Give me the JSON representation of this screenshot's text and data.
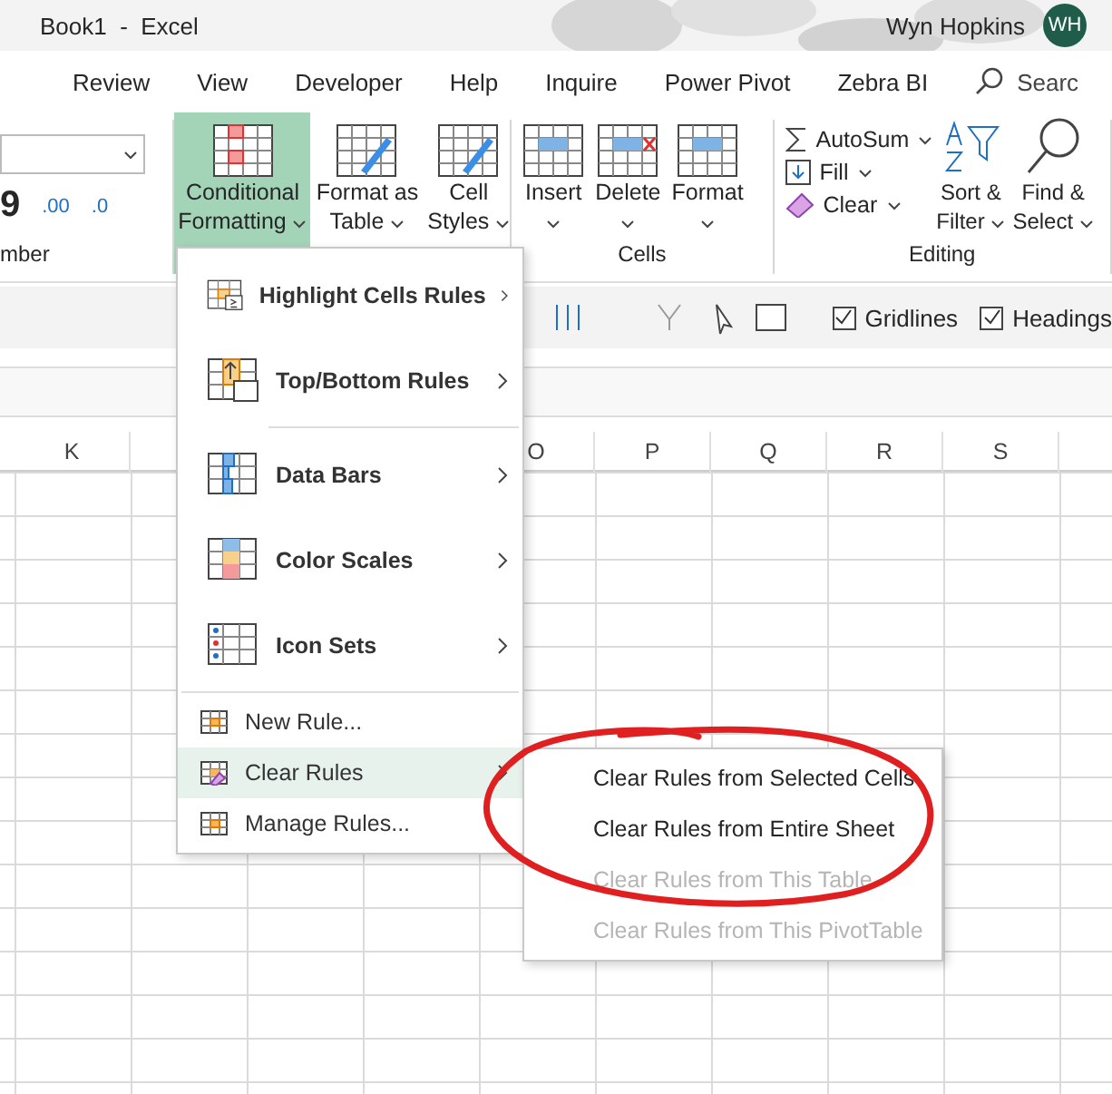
{
  "window": {
    "title": "Book1  -  Excel",
    "user": "Wyn Hopkins",
    "avatar": "WH"
  },
  "ribbon_tabs": [
    {
      "label": "Review"
    },
    {
      "label": "View"
    },
    {
      "label": "Developer"
    },
    {
      "label": "Help"
    },
    {
      "label": "Inquire"
    },
    {
      "label": "Power Pivot"
    },
    {
      "label": "Zebra BI"
    }
  ],
  "search": {
    "placeholder": "Searc"
  },
  "number_group": {
    "label": "mber",
    "comma": "9",
    "increase": ".00",
    "decrease": ".0"
  },
  "styles_group": [
    {
      "label": [
        "Conditional",
        "Formatting"
      ],
      "selected": true
    },
    {
      "label": [
        "Format as",
        "Table"
      ],
      "selected": false
    },
    {
      "label": [
        "Cell",
        "Styles"
      ],
      "selected": false
    }
  ],
  "cells_group": {
    "label": "Cells",
    "buttons": [
      "Insert",
      "Delete",
      "Format"
    ]
  },
  "editing_group": {
    "label": "Editing",
    "small": [
      "AutoSum",
      "Fill",
      "Clear"
    ],
    "large": [
      [
        "Sort &",
        "Filter"
      ],
      [
        "Find &",
        "Select"
      ]
    ]
  },
  "toolbar": {
    "checkboxes": [
      {
        "label": "Gridlines",
        "checked": true
      },
      {
        "label": "Headings",
        "checked": true
      }
    ]
  },
  "columns": [
    "K",
    "O",
    "P",
    "Q",
    "R",
    "S"
  ],
  "menu": {
    "items": [
      {
        "kind": "large",
        "label": "Highlight Cells Rules",
        "submenu": true,
        "selected": false
      },
      {
        "kind": "large",
        "label": "Top/Bottom Rules",
        "submenu": true,
        "selected": false
      },
      {
        "kind": "large",
        "label": "Data Bars",
        "submenu": true,
        "selected": false
      },
      {
        "kind": "large",
        "label": "Color Scales",
        "submenu": true,
        "selected": false
      },
      {
        "kind": "large",
        "label": "Icon Sets",
        "submenu": true,
        "selected": false
      },
      {
        "kind": "small",
        "label": "New Rule...",
        "submenu": false,
        "selected": false
      },
      {
        "kind": "small",
        "label": "Clear Rules",
        "submenu": true,
        "selected": true
      },
      {
        "kind": "small",
        "label": "Manage Rules...",
        "submenu": false,
        "selected": false
      }
    ]
  },
  "submenu": {
    "items": [
      {
        "label": "Clear Rules from Selected Cells",
        "disabled": false
      },
      {
        "label": "Clear Rules from Entire Sheet",
        "disabled": false
      },
      {
        "label": "Clear Rules from This Table",
        "disabled": true
      },
      {
        "label": "Clear Rules from This PivotTable",
        "disabled": true
      }
    ]
  }
}
